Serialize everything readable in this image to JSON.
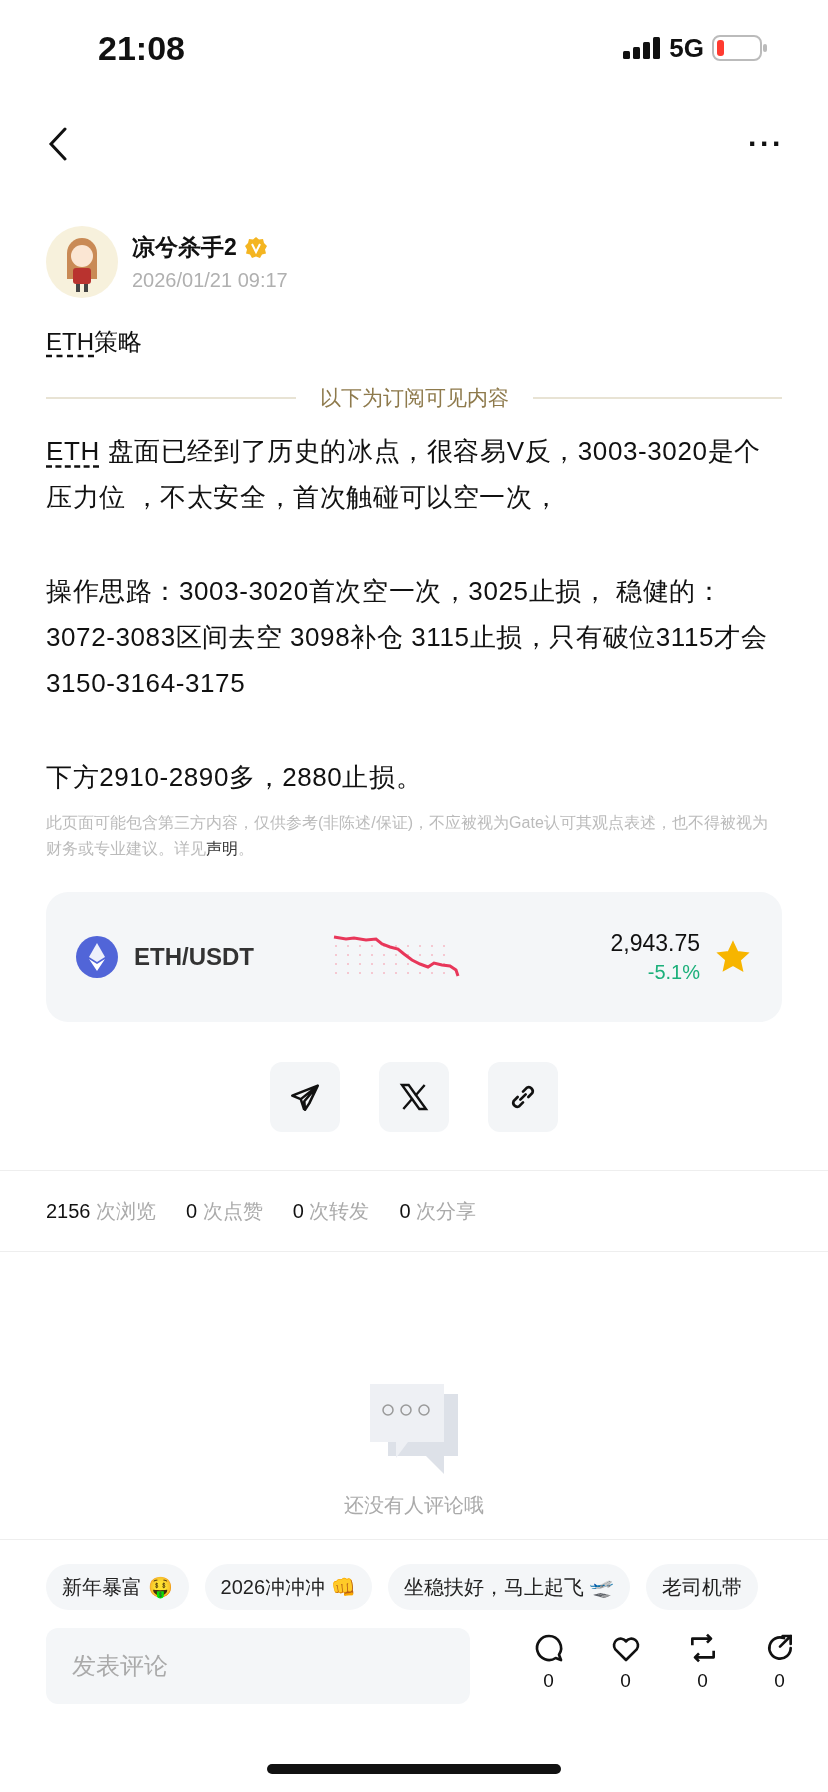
{
  "status_bar": {
    "time": "21:08",
    "network": "5G"
  },
  "nav": {
    "more": "···"
  },
  "author": {
    "name": "凉兮杀手2",
    "verified": true,
    "date": "2026/01/21 09:17"
  },
  "title": {
    "ticker": "ETH",
    "text": "策略"
  },
  "subscriber_divider": "以下为订阅可见内容",
  "paragraphs": [
    {
      "ticker": "ETH",
      "text": " 盘面已经到了历史的冰点，很容易V反，3003-3020是个压力位 ，不太安全，首次触碰可以空一次，"
    },
    {
      "text": " 操作思路：3003-3020首次空一次，3025止损， 稳健的：3072-3083区间去空 3098补仓 3115止损，只有破位3115才会3150-3164-3175"
    },
    {
      "text": "下方2910-2890多，2880止损。"
    }
  ],
  "disclaimer": {
    "text": "此页面可能包含第三方内容，仅供参考(非陈述/保证)，不应被视为Gate认可其观点表述，也不得被视为财务或专业建议。详见",
    "link": "声明",
    "end": "。"
  },
  "ticker_card": {
    "pair": "ETH/USDT",
    "price": "2,943.75",
    "change": "-5.1%",
    "favorited": true
  },
  "share_buttons": [
    {
      "kind": "telegram"
    },
    {
      "kind": "x"
    },
    {
      "kind": "link"
    }
  ],
  "stats": [
    {
      "count": "2156",
      "unit": "次浏览"
    },
    {
      "count": "0",
      "unit": "次点赞"
    },
    {
      "count": "0",
      "unit": "次转发"
    },
    {
      "count": "0",
      "unit": "次分享"
    }
  ],
  "empty_comments": "还没有人评论哦",
  "quick_replies": [
    "新年暴富 🤑",
    "2026冲冲冲 👊",
    "坐稳扶好，马上起飞 🛫",
    "老司机带"
  ],
  "comment_field": {
    "placeholder": "发表评论"
  },
  "actions": [
    {
      "kind": "comment",
      "count": "0"
    },
    {
      "kind": "like",
      "count": "0"
    },
    {
      "kind": "repost",
      "count": "0"
    },
    {
      "kind": "share",
      "count": "0"
    }
  ]
}
